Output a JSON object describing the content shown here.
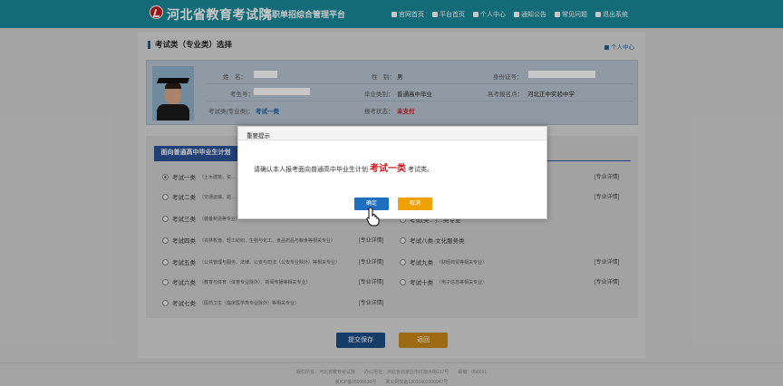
{
  "header": {
    "brand": "河北省教育考试院",
    "subtitle": "高职单招综合管理平台",
    "nav": [
      {
        "label": "官网首页",
        "icon": "home-icon"
      },
      {
        "label": "平台首页",
        "icon": "house-icon"
      },
      {
        "label": "个人中心",
        "icon": "user-icon"
      },
      {
        "label": "通知公告",
        "icon": "notice-icon"
      },
      {
        "label": "常见问题",
        "icon": "question-icon"
      },
      {
        "label": "退出系统",
        "icon": "logout-icon"
      }
    ]
  },
  "page": {
    "section_title": "考试类（专业类）选择",
    "personal_center": "个人中心"
  },
  "info": {
    "name_label": "姓　名：",
    "gender_label": "性　别：",
    "gender_value": "男",
    "id_label": "身份证号：",
    "exam_no_label": "考生号：",
    "grad_type_label": "毕业类别：",
    "grad_type_value": "普通高中毕业",
    "exam_area_label": "高考报名点：",
    "exam_area_value": "河北正中实验中学",
    "exam_class_label": "考试类(专业类)：",
    "exam_class_value": "考试一类",
    "status_label": "报考状态：",
    "status_value": "未支付"
  },
  "plan_tab": "面向普通高中毕业生计划",
  "options": [
    {
      "name": "考试一类",
      "desc": "（土木建筑、资…",
      "checked": true
    },
    {
      "name": "考试二类",
      "desc": "（交通运输、能…",
      "checked": false
    },
    {
      "name": "考试三类",
      "desc": "（装备制造等专业）",
      "checked": false
    },
    {
      "name": "考试四类",
      "desc": "（农林牧渔、轻工纺织、生物与化工、食品药品与粮食等相关专业）",
      "checked": false
    },
    {
      "name": "考试五类",
      "desc": "（公共管理与服务、法律、公安与司法（公安专业除外）等相关专业）",
      "checked": false
    },
    {
      "name": "考试六类",
      "desc": "（教育与体育（体育专业除外）、新闻传播等相关专业）",
      "checked": false
    },
    {
      "name": "考试七类",
      "desc": "（医药卫生（临床医学类专业除外）等相关专业）",
      "checked": false
    }
  ],
  "options_right": [
    {
      "name": "考试(类…)…类专业",
      "desc": "",
      "checked": false
    },
    {
      "name": "考试八类-文化服务类",
      "desc": "",
      "checked": false
    },
    {
      "name": "考试九类",
      "desc": "（财经商贸等相关专业）",
      "checked": false
    },
    {
      "name": "考试十类",
      "desc": "（电子信息等相关专业）",
      "checked": false
    }
  ],
  "detail_label": "[专业详情]",
  "buttons": {
    "submit": "提交保存",
    "back": "返回"
  },
  "footer": {
    "line1": "版权所有：河北省教育考试院　　办公地址：河北省石家庄市红旗大街217号　　邮编：050091",
    "line2": "冀ICP备05006630号　　冀公网安备13010402000947号"
  },
  "modal": {
    "title": "重要提示",
    "msg_prefix": "请确认本人报考面向普通高中毕业生计划",
    "msg_highlight": "考试一类",
    "msg_suffix": "考试类。",
    "ok": "确定",
    "cancel": "取消"
  }
}
